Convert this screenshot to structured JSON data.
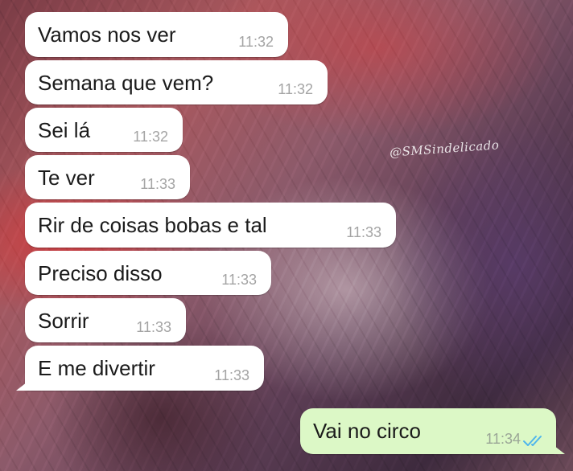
{
  "chat": {
    "watermark": "@SMSindelicado",
    "messages": [
      {
        "text": "Vamos nos ver",
        "time": "11:32"
      },
      {
        "text": "Semana que vem?",
        "time": "11:32"
      },
      {
        "text": "Sei lá",
        "time": "11:32"
      },
      {
        "text": "Te ver",
        "time": "11:33"
      },
      {
        "text": "Rir de coisas bobas e tal",
        "time": "11:33"
      },
      {
        "text": "Preciso disso",
        "time": "11:33"
      },
      {
        "text": "Sorrir",
        "time": "11:33"
      },
      {
        "text": "E me divertir",
        "time": "11:33"
      },
      {
        "text": "Vai no circo",
        "time": "11:34",
        "status_icon": "double-check-read-icon"
      }
    ]
  },
  "colors": {
    "incoming_bubble": "#ffffff",
    "outgoing_bubble": "#dcf8c6",
    "read_tick": "#4fb6ec"
  }
}
